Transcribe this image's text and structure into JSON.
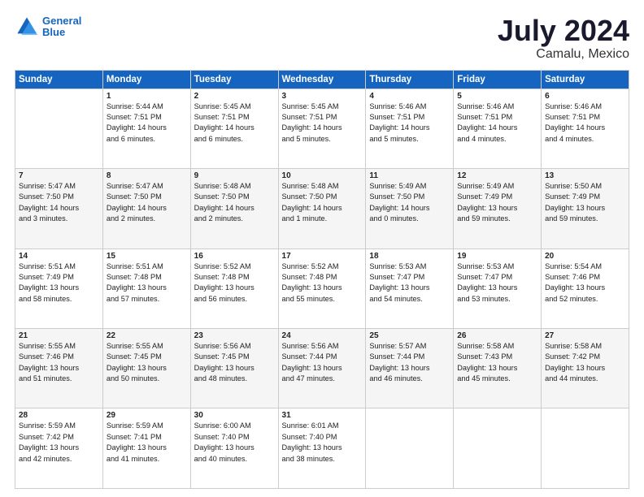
{
  "logo": {
    "line1": "General",
    "line2": "Blue"
  },
  "title": "July 2024",
  "subtitle": "Camalu, Mexico",
  "days_header": [
    "Sunday",
    "Monday",
    "Tuesday",
    "Wednesday",
    "Thursday",
    "Friday",
    "Saturday"
  ],
  "weeks": [
    [
      {
        "day": "",
        "info": ""
      },
      {
        "day": "1",
        "info": "Sunrise: 5:44 AM\nSunset: 7:51 PM\nDaylight: 14 hours\nand 6 minutes."
      },
      {
        "day": "2",
        "info": "Sunrise: 5:45 AM\nSunset: 7:51 PM\nDaylight: 14 hours\nand 6 minutes."
      },
      {
        "day": "3",
        "info": "Sunrise: 5:45 AM\nSunset: 7:51 PM\nDaylight: 14 hours\nand 5 minutes."
      },
      {
        "day": "4",
        "info": "Sunrise: 5:46 AM\nSunset: 7:51 PM\nDaylight: 14 hours\nand 5 minutes."
      },
      {
        "day": "5",
        "info": "Sunrise: 5:46 AM\nSunset: 7:51 PM\nDaylight: 14 hours\nand 4 minutes."
      },
      {
        "day": "6",
        "info": "Sunrise: 5:46 AM\nSunset: 7:51 PM\nDaylight: 14 hours\nand 4 minutes."
      }
    ],
    [
      {
        "day": "7",
        "info": "Sunrise: 5:47 AM\nSunset: 7:50 PM\nDaylight: 14 hours\nand 3 minutes."
      },
      {
        "day": "8",
        "info": "Sunrise: 5:47 AM\nSunset: 7:50 PM\nDaylight: 14 hours\nand 2 minutes."
      },
      {
        "day": "9",
        "info": "Sunrise: 5:48 AM\nSunset: 7:50 PM\nDaylight: 14 hours\nand 2 minutes."
      },
      {
        "day": "10",
        "info": "Sunrise: 5:48 AM\nSunset: 7:50 PM\nDaylight: 14 hours\nand 1 minute."
      },
      {
        "day": "11",
        "info": "Sunrise: 5:49 AM\nSunset: 7:50 PM\nDaylight: 14 hours\nand 0 minutes."
      },
      {
        "day": "12",
        "info": "Sunrise: 5:49 AM\nSunset: 7:49 PM\nDaylight: 13 hours\nand 59 minutes."
      },
      {
        "day": "13",
        "info": "Sunrise: 5:50 AM\nSunset: 7:49 PM\nDaylight: 13 hours\nand 59 minutes."
      }
    ],
    [
      {
        "day": "14",
        "info": "Sunrise: 5:51 AM\nSunset: 7:49 PM\nDaylight: 13 hours\nand 58 minutes."
      },
      {
        "day": "15",
        "info": "Sunrise: 5:51 AM\nSunset: 7:48 PM\nDaylight: 13 hours\nand 57 minutes."
      },
      {
        "day": "16",
        "info": "Sunrise: 5:52 AM\nSunset: 7:48 PM\nDaylight: 13 hours\nand 56 minutes."
      },
      {
        "day": "17",
        "info": "Sunrise: 5:52 AM\nSunset: 7:48 PM\nDaylight: 13 hours\nand 55 minutes."
      },
      {
        "day": "18",
        "info": "Sunrise: 5:53 AM\nSunset: 7:47 PM\nDaylight: 13 hours\nand 54 minutes."
      },
      {
        "day": "19",
        "info": "Sunrise: 5:53 AM\nSunset: 7:47 PM\nDaylight: 13 hours\nand 53 minutes."
      },
      {
        "day": "20",
        "info": "Sunrise: 5:54 AM\nSunset: 7:46 PM\nDaylight: 13 hours\nand 52 minutes."
      }
    ],
    [
      {
        "day": "21",
        "info": "Sunrise: 5:55 AM\nSunset: 7:46 PM\nDaylight: 13 hours\nand 51 minutes."
      },
      {
        "day": "22",
        "info": "Sunrise: 5:55 AM\nSunset: 7:45 PM\nDaylight: 13 hours\nand 50 minutes."
      },
      {
        "day": "23",
        "info": "Sunrise: 5:56 AM\nSunset: 7:45 PM\nDaylight: 13 hours\nand 48 minutes."
      },
      {
        "day": "24",
        "info": "Sunrise: 5:56 AM\nSunset: 7:44 PM\nDaylight: 13 hours\nand 47 minutes."
      },
      {
        "day": "25",
        "info": "Sunrise: 5:57 AM\nSunset: 7:44 PM\nDaylight: 13 hours\nand 46 minutes."
      },
      {
        "day": "26",
        "info": "Sunrise: 5:58 AM\nSunset: 7:43 PM\nDaylight: 13 hours\nand 45 minutes."
      },
      {
        "day": "27",
        "info": "Sunrise: 5:58 AM\nSunset: 7:42 PM\nDaylight: 13 hours\nand 44 minutes."
      }
    ],
    [
      {
        "day": "28",
        "info": "Sunrise: 5:59 AM\nSunset: 7:42 PM\nDaylight: 13 hours\nand 42 minutes."
      },
      {
        "day": "29",
        "info": "Sunrise: 5:59 AM\nSunset: 7:41 PM\nDaylight: 13 hours\nand 41 minutes."
      },
      {
        "day": "30",
        "info": "Sunrise: 6:00 AM\nSunset: 7:40 PM\nDaylight: 13 hours\nand 40 minutes."
      },
      {
        "day": "31",
        "info": "Sunrise: 6:01 AM\nSunset: 7:40 PM\nDaylight: 13 hours\nand 38 minutes."
      },
      {
        "day": "",
        "info": ""
      },
      {
        "day": "",
        "info": ""
      },
      {
        "day": "",
        "info": ""
      }
    ]
  ]
}
